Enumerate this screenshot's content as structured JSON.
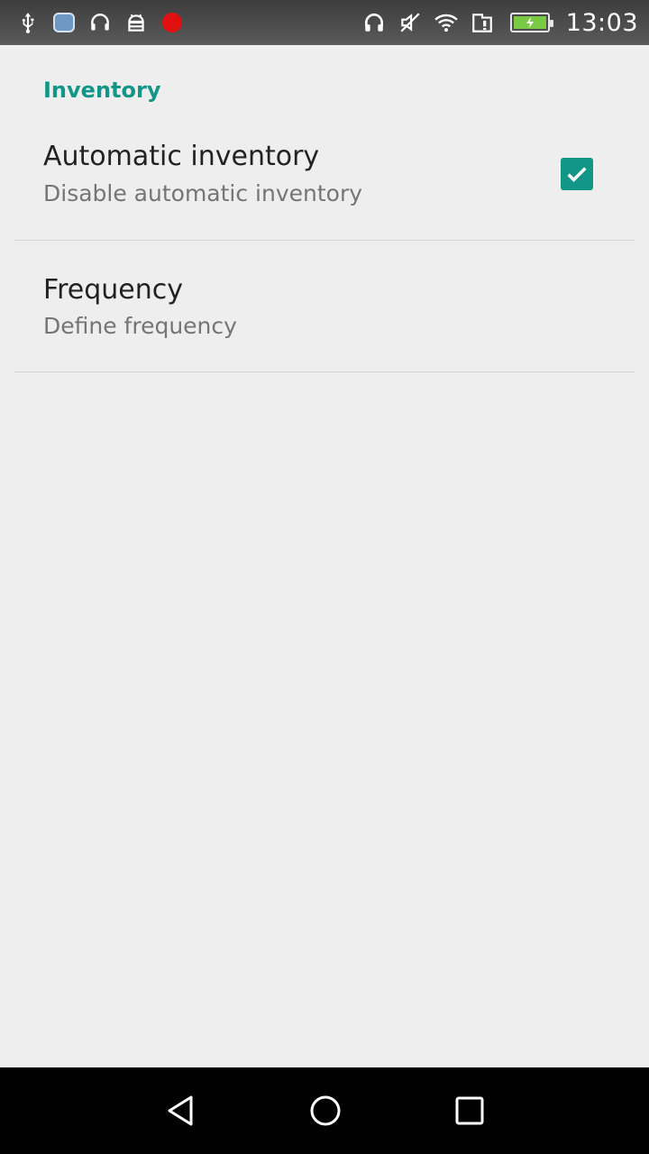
{
  "status_bar": {
    "time": "13:03",
    "battery_level": "charging",
    "record_color": "#e01010",
    "left_icons": [
      "usb-icon",
      "cloud-app-icon",
      "headset-icon",
      "android-debug-icon",
      "record-icon"
    ],
    "right_icons": [
      "headphones-icon",
      "mute-icon",
      "wifi-icon",
      "sim-alert-icon",
      "battery-icon"
    ]
  },
  "settings": {
    "section_header": "Inventory",
    "accent_color": "#129688",
    "items": [
      {
        "title": "Automatic inventory",
        "summary": "Disable automatic inventory",
        "checked": true
      },
      {
        "title": "Frequency",
        "summary": "Define frequency"
      }
    ]
  },
  "nav_bar": {
    "buttons": [
      "back-icon",
      "home-icon",
      "recents-icon"
    ]
  }
}
